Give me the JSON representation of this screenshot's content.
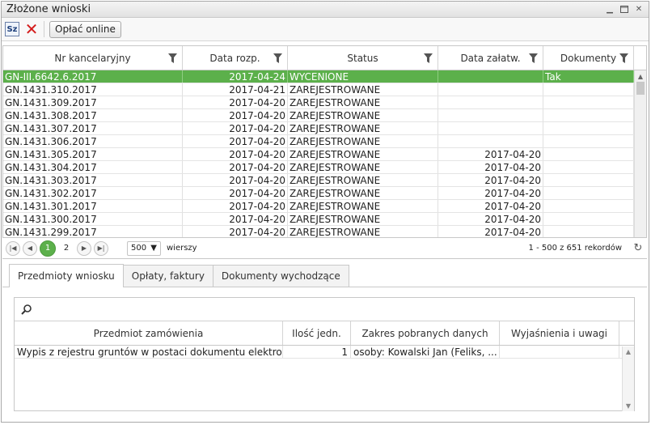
{
  "window": {
    "title": "Złożone wnioski"
  },
  "toolbar": {
    "sz_label": "Sz",
    "pay_label": "Opłać online"
  },
  "grid": {
    "columns": [
      "Nr kancelaryjny",
      "Data rozp.",
      "Status",
      "Data załatw.",
      "Dokumenty"
    ],
    "rows": [
      [
        "GN-III.6642.6.2017",
        "2017-04-24",
        "WYCENIONE",
        "",
        "Tak"
      ],
      [
        "GN.1431.310.2017",
        "2017-04-21",
        "ZAREJESTROWANE",
        "",
        ""
      ],
      [
        "GN.1431.309.2017",
        "2017-04-20",
        "ZAREJESTROWANE",
        "",
        ""
      ],
      [
        "GN.1431.308.2017",
        "2017-04-20",
        "ZAREJESTROWANE",
        "",
        ""
      ],
      [
        "GN.1431.307.2017",
        "2017-04-20",
        "ZAREJESTROWANE",
        "",
        ""
      ],
      [
        "GN.1431.306.2017",
        "2017-04-20",
        "ZAREJESTROWANE",
        "",
        ""
      ],
      [
        "GN.1431.305.2017",
        "2017-04-20",
        "ZAREJESTROWANE",
        "2017-04-20",
        ""
      ],
      [
        "GN.1431.304.2017",
        "2017-04-20",
        "ZAREJESTROWANE",
        "2017-04-20",
        ""
      ],
      [
        "GN.1431.303.2017",
        "2017-04-20",
        "ZAREJESTROWANE",
        "2017-04-20",
        ""
      ],
      [
        "GN.1431.302.2017",
        "2017-04-20",
        "ZAREJESTROWANE",
        "2017-04-20",
        ""
      ],
      [
        "GN.1431.301.2017",
        "2017-04-20",
        "ZAREJESTROWANE",
        "2017-04-20",
        ""
      ],
      [
        "GN.1431.300.2017",
        "2017-04-20",
        "ZAREJESTROWANE",
        "2017-04-20",
        ""
      ],
      [
        "GN.1431.299.2017",
        "2017-04-20",
        "ZAREJESTROWANE",
        "2017-04-20",
        ""
      ]
    ],
    "selected_row": 0
  },
  "pager": {
    "pages": [
      "1",
      "2"
    ],
    "page_size": "500",
    "page_size_label": "wierszy",
    "info": "1 - 500 z 651 rekordów"
  },
  "tabs": [
    "Przedmioty wniosku",
    "Opłaty, faktury",
    "Dokumenty wychodzące"
  ],
  "subgrid": {
    "columns": [
      "Przedmiot zamówienia",
      "Ilość jedn.",
      "Zakres pobranych danych",
      "Wyjaśnienia i uwagi"
    ],
    "rows": [
      [
        "Wypis z rejestru gruntów w postaci dokumentu elektro...",
        "1",
        "osoby: Kowalski Jan (Feliks, ...",
        ""
      ]
    ]
  },
  "colors": {
    "selected_row": "#5cb04b",
    "delete_icon": "#d41b1b"
  }
}
